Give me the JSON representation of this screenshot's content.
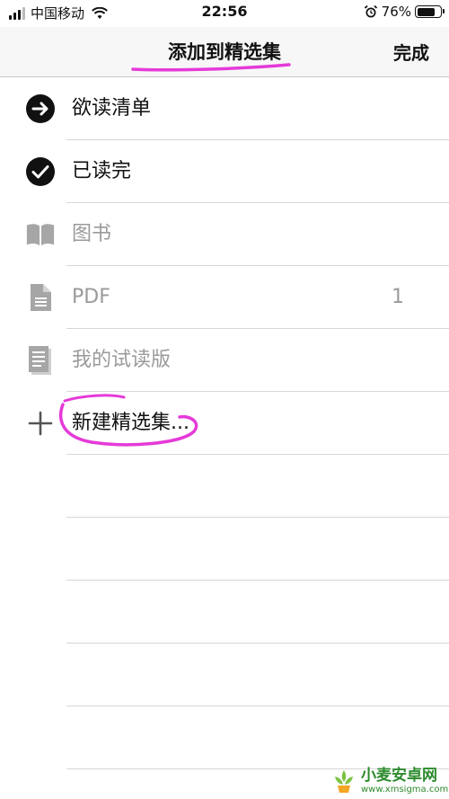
{
  "status_bar": {
    "carrier": "中国移动",
    "time": "22:56",
    "battery": "76%",
    "battery_level": 0.76
  },
  "nav": {
    "title": "添加到精选集",
    "done_label": "完成"
  },
  "rows": [
    {
      "label": "欲读清单",
      "icon": "arrow-right-circle-icon",
      "enabled": true,
      "count": ""
    },
    {
      "label": "已读完",
      "icon": "checkmark-circle-icon",
      "enabled": true,
      "count": ""
    },
    {
      "label": "图书",
      "icon": "book-icon",
      "enabled": false,
      "count": ""
    },
    {
      "label": "PDF",
      "icon": "document-icon",
      "enabled": false,
      "count": "1"
    },
    {
      "label": "我的试读版",
      "icon": "sample-pages-icon",
      "enabled": false,
      "count": ""
    },
    {
      "label": "新建精选集...",
      "icon": "plus-icon",
      "enabled": true,
      "count": ""
    }
  ],
  "watermark": {
    "name": "小麦安卓网",
    "url": "www.xmsigma.com"
  },
  "colors": {
    "annotation": "#e53ad8",
    "disabled": "#9a9a9a",
    "watermark": "#2c8a2c"
  }
}
